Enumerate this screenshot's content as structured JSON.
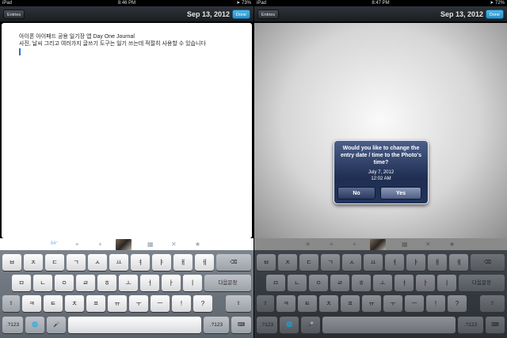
{
  "left": {
    "status": {
      "carrier": "iPad",
      "time": "8:46 PM",
      "right": "➤ 73%"
    },
    "navbar": {
      "entries_label": "Entries",
      "date": "Sep 13, 2012",
      "done_label": "Done"
    },
    "entry": {
      "line1": "아이폰 아이패드 공용 일기장 앱 Day One Journal",
      "line2": "사진, 날씨 그리고 여러가지 글쓰기 도구는 일기 쓰는데 적절히 사용할 수 있습니다"
    },
    "toolbar": {
      "temperature": "64°"
    }
  },
  "right": {
    "status": {
      "carrier": "iPad",
      "time": "8:47 PM",
      "right": "➤ 72%"
    },
    "navbar": {
      "entries_label": "Entries",
      "date": "Sep 13, 2012",
      "done_label": "Done"
    },
    "alert": {
      "title": "Would you like to change the entry date / time to the Photo's time?",
      "date": "July 7, 2012",
      "time": "12:02 AM",
      "no_label": "No",
      "yes_label": "Yes"
    }
  },
  "keyboard": {
    "row1": [
      "ㅂ",
      "ㅈ",
      "ㄷ",
      "ㄱ",
      "ㅅ",
      "ㅛ",
      "ㅕ",
      "ㅑ",
      "ㅐ",
      "ㅔ"
    ],
    "row2": [
      "ㅁ",
      "ㄴ",
      "ㅇ",
      "ㄹ",
      "ㅎ",
      "ㅗ",
      "ㅓ",
      "ㅏ",
      "ㅣ"
    ],
    "row3": [
      "ㅋ",
      "ㅌ",
      "ㅊ",
      "ㅍ",
      "ㅠ",
      "ㅜ",
      "ㅡ",
      "!",
      "?"
    ],
    "return_label": "다음문장",
    "numbers_label": ".?123",
    "backspace_icon": "⌫",
    "shift_icon": "⇧",
    "globe_icon": "🌐",
    "mic_icon": "🎤",
    "hide_keyboard_icon": "⌨"
  }
}
